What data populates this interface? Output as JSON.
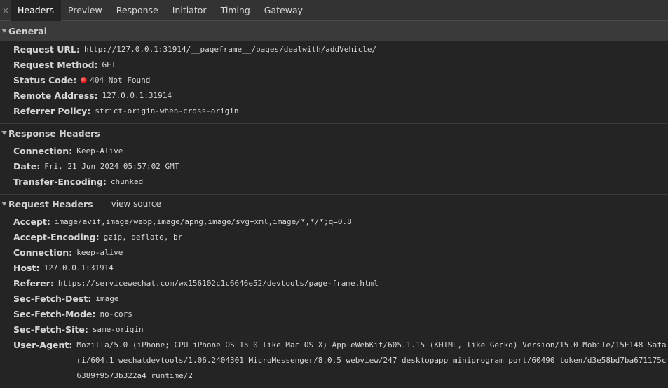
{
  "tabs": {
    "close": "×",
    "items": [
      {
        "label": "Headers"
      },
      {
        "label": "Preview"
      },
      {
        "label": "Response"
      },
      {
        "label": "Initiator"
      },
      {
        "label": "Timing"
      },
      {
        "label": "Gateway"
      }
    ]
  },
  "general": {
    "title": "General",
    "request_url": {
      "key": "Request URL",
      "value": "http://127.0.0.1:31914/__pageframe__/pages/dealwith/addVehicle/"
    },
    "request_method": {
      "key": "Request Method",
      "value": "GET"
    },
    "status_code": {
      "key": "Status Code",
      "value": "404 Not Found",
      "dot_color": "#e01818"
    },
    "remote_address": {
      "key": "Remote Address",
      "value": "127.0.0.1:31914"
    },
    "referrer_policy": {
      "key": "Referrer Policy",
      "value": "strict-origin-when-cross-origin"
    }
  },
  "response_headers": {
    "title": "Response Headers",
    "items": [
      {
        "key": "Connection",
        "value": "Keep-Alive"
      },
      {
        "key": "Date",
        "value": "Fri, 21 Jun 2024 05:57:02 GMT"
      },
      {
        "key": "Transfer-Encoding",
        "value": "chunked"
      }
    ]
  },
  "request_headers": {
    "title": "Request Headers",
    "view_source": "view source",
    "items": [
      {
        "key": "Accept",
        "value": "image/avif,image/webp,image/apng,image/svg+xml,image/*,*/*;q=0.8"
      },
      {
        "key": "Accept-Encoding",
        "value": "gzip, deflate, br"
      },
      {
        "key": "Connection",
        "value": "keep-alive"
      },
      {
        "key": "Host",
        "value": "127.0.0.1:31914"
      },
      {
        "key": "Referer",
        "value": "https://servicewechat.com/wx156102c1c6646e52/devtools/page-frame.html"
      },
      {
        "key": "Sec-Fetch-Dest",
        "value": "image"
      },
      {
        "key": "Sec-Fetch-Mode",
        "value": "no-cors"
      },
      {
        "key": "Sec-Fetch-Site",
        "value": "same-origin"
      },
      {
        "key": "User-Agent",
        "value": "Mozilla/5.0 (iPhone; CPU iPhone OS 15_0 like Mac OS X) AppleWebKit/605.1.15 (KHTML, like Gecko) Version/15.0 Mobile/15E148 Safari/604.1 wechatdevtools/1.06.2404301 MicroMessenger/8.0.5 webview/247 desktopapp miniprogram port/60490 token/d3e58bd7ba671175c6389f9573b322a4 runtime/2"
      }
    ]
  }
}
